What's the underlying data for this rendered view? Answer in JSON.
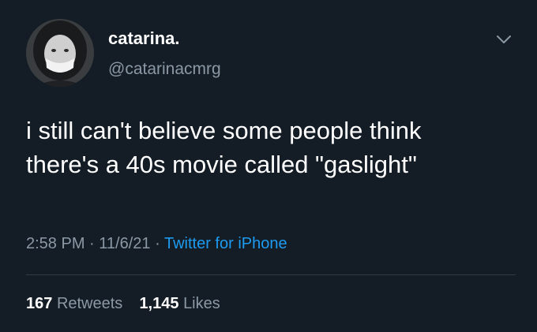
{
  "user": {
    "display_name": "catarina.",
    "handle": "@catarinacmrg"
  },
  "tweet": {
    "lines": [
      "i still can't believe some people think",
      "there's a 40s movie called \"gaslight\""
    ],
    "time": "2:58 PM",
    "sep": "·",
    "date": "11/6/21",
    "source": "Twitter for iPhone"
  },
  "stats": {
    "retweets_count": "167",
    "retweets_label": "Retweets",
    "likes_count": "1,145",
    "likes_label": "Likes"
  },
  "icons": {
    "menu": "chevron-down-icon"
  },
  "colors": {
    "background": "#141d26",
    "text": "#ffffff",
    "secondary": "#8b98a5",
    "link": "#1d9bf0"
  }
}
